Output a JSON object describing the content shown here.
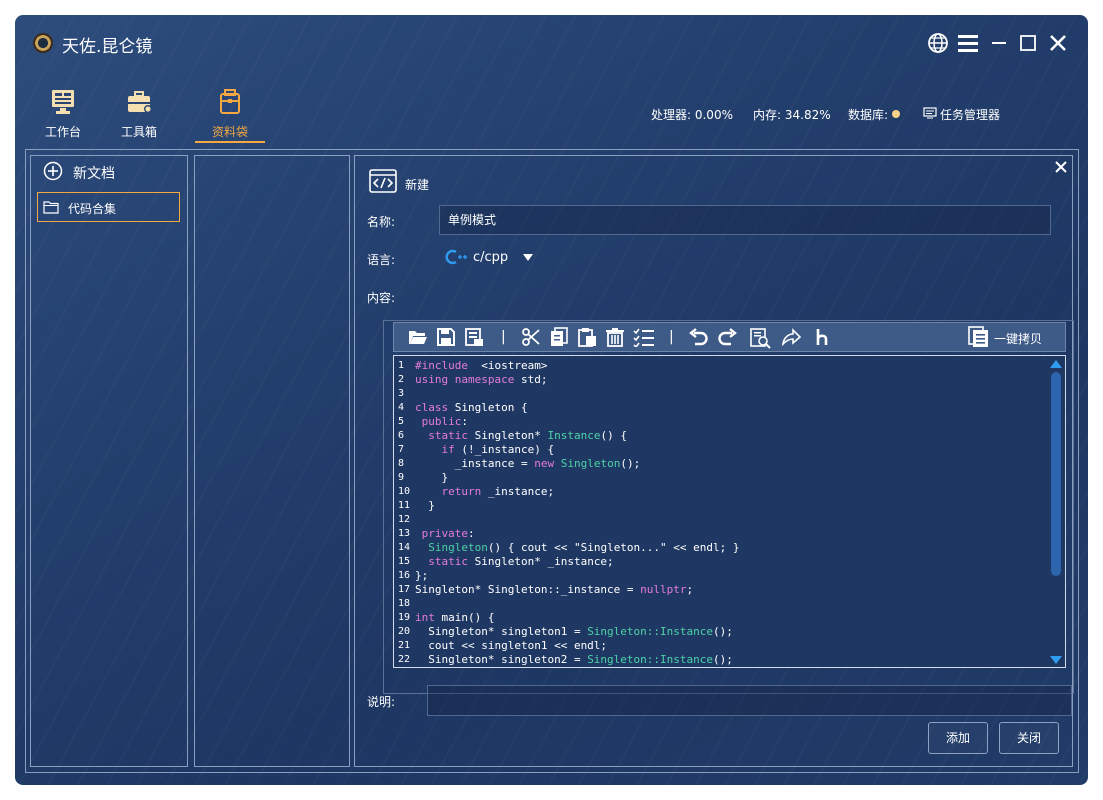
{
  "app": {
    "title": "天佐.昆仑镜"
  },
  "nav": [
    {
      "label": "工作台",
      "icon": "monitor-icon",
      "active": false
    },
    {
      "label": "工具箱",
      "icon": "toolbox-icon",
      "active": false
    },
    {
      "label": "资料袋",
      "icon": "folder-bag-icon",
      "active": true
    }
  ],
  "status": {
    "cpu": "处理器: 0.00%",
    "memory": "内存: 34.82%",
    "database": "数据库:",
    "database_status_color": "#f5d48a",
    "task_manager": "任务管理器"
  },
  "sidebar": {
    "new_doc": "新文档",
    "folders": [
      {
        "label": "代码合集",
        "selected": true
      }
    ]
  },
  "form": {
    "header": "新建",
    "name_label": "名称:",
    "name_value": "单例模式",
    "language_label": "语言:",
    "language_value": "c/cpp",
    "content_label": "内容:",
    "description_label": "说明:",
    "description_value": "",
    "copy_all": "一键拷贝",
    "add_button": "添加",
    "close_button": "关闭"
  },
  "toolbar_icons": [
    "open-folder-icon",
    "save-icon",
    "save-as-icon",
    "cut-icon",
    "copy-icon",
    "paste-icon",
    "delete-icon",
    "checklist-icon",
    "undo-icon",
    "redo-icon",
    "find-icon",
    "share-icon",
    "heading-icon"
  ],
  "code": [
    {
      "n": "1",
      "t": [
        [
          "kw",
          "#include"
        ],
        [
          "",
          "  <iostream>"
        ]
      ]
    },
    {
      "n": "2",
      "t": [
        [
          "kw",
          "using namespace"
        ],
        [
          "",
          " std;"
        ]
      ]
    },
    {
      "n": "3",
      "t": []
    },
    {
      "n": "4",
      "t": [
        [
          "kw",
          "class"
        ],
        [
          "",
          " Singleton {"
        ]
      ]
    },
    {
      "n": "5",
      "t": [
        [
          "kw",
          " public"
        ],
        [
          "",
          ":"
        ]
      ]
    },
    {
      "n": "6",
      "t": [
        [
          "kw",
          "  static"
        ],
        [
          "",
          " Singleton* "
        ],
        [
          "fn",
          "Instance"
        ],
        [
          "",
          "() {"
        ]
      ]
    },
    {
      "n": "7",
      "t": [
        [
          "kw",
          "    if"
        ],
        [
          "",
          " (!_instance) {"
        ]
      ]
    },
    {
      "n": "8",
      "t": [
        [
          "",
          "      _instance = "
        ],
        [
          "kw",
          "new"
        ],
        [
          "",
          " "
        ],
        [
          "fn",
          "Singleton"
        ],
        [
          "",
          "();"
        ]
      ]
    },
    {
      "n": "9",
      "t": [
        [
          "",
          "    }"
        ]
      ]
    },
    {
      "n": "10",
      "t": [
        [
          "kw",
          "    return"
        ],
        [
          "",
          " _instance;"
        ]
      ]
    },
    {
      "n": "11",
      "t": [
        [
          "",
          "  }"
        ]
      ]
    },
    {
      "n": "12",
      "t": []
    },
    {
      "n": "13",
      "t": [
        [
          "kw",
          " private"
        ],
        [
          "",
          ":"
        ]
      ]
    },
    {
      "n": "14",
      "t": [
        [
          "fn",
          "  Singleton"
        ],
        [
          "",
          "() { cout << \"Singleton...\" << endl; }"
        ]
      ]
    },
    {
      "n": "15",
      "t": [
        [
          "kw",
          "  static"
        ],
        [
          "",
          " Singleton* _instance;"
        ]
      ]
    },
    {
      "n": "16",
      "t": [
        [
          "",
          "};"
        ]
      ]
    },
    {
      "n": "17",
      "t": [
        [
          "",
          "Singleton* Singleton::_instance = "
        ],
        [
          "kw",
          "nullptr"
        ],
        [
          "",
          ";"
        ]
      ]
    },
    {
      "n": "18",
      "t": []
    },
    {
      "n": "19",
      "t": [
        [
          "kw",
          "int"
        ],
        [
          "",
          " main() {"
        ]
      ]
    },
    {
      "n": "20",
      "t": [
        [
          "",
          "  Singleton* singleton1 = "
        ],
        [
          "fn",
          "Singleton::Instance"
        ],
        [
          "",
          "();"
        ]
      ]
    },
    {
      "n": "21",
      "t": [
        [
          "",
          "  cout << singleton1 << endl;"
        ]
      ]
    },
    {
      "n": "22",
      "t": [
        [
          "",
          "  Singleton* singleton2 = "
        ],
        [
          "fn",
          "Singleton::Instance"
        ],
        [
          "",
          "();"
        ]
      ]
    }
  ]
}
